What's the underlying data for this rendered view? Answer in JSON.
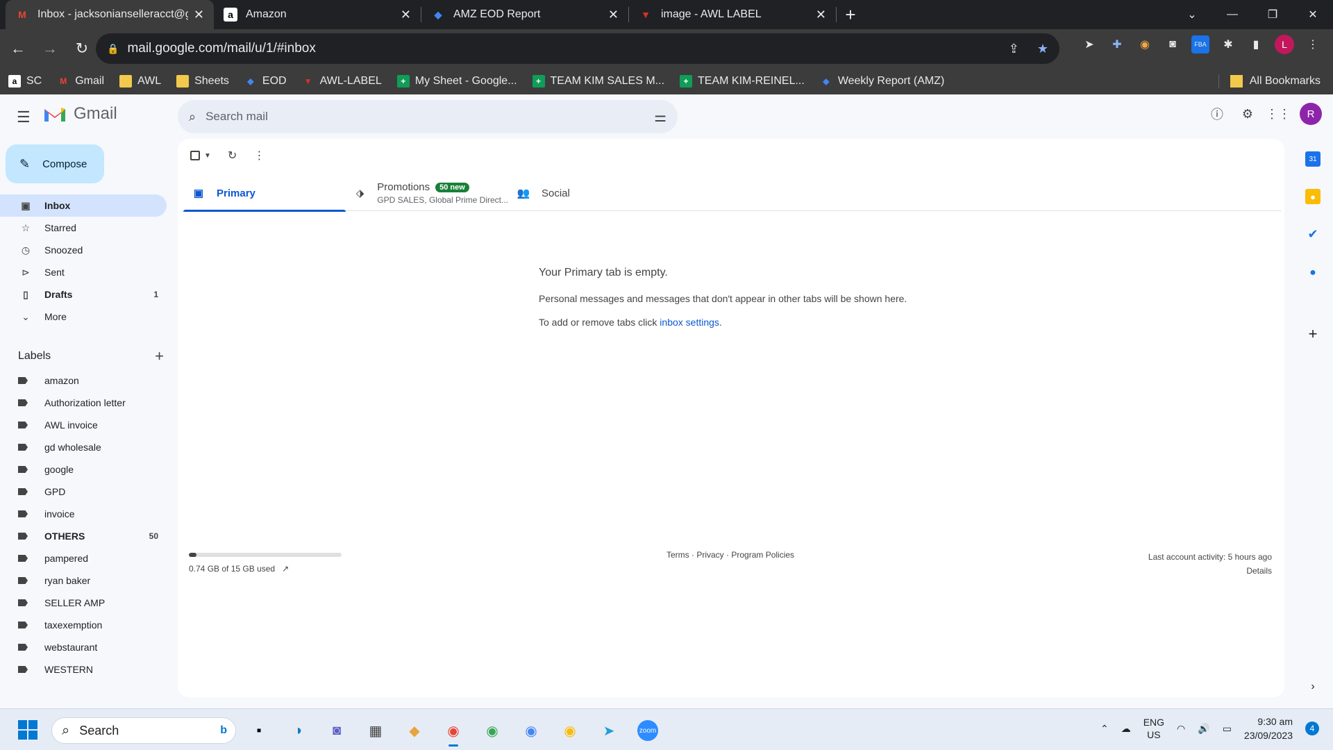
{
  "browser": {
    "tabs": [
      {
        "title": "Inbox - jacksonianselleracct@gm",
        "icon": "gmail-icon"
      },
      {
        "title": "Amazon",
        "icon": "amazon-icon"
      },
      {
        "title": "AMZ EOD Report",
        "icon": "report-icon"
      },
      {
        "title": "image - AWL LABEL",
        "icon": "awl-icon"
      }
    ],
    "url": "mail.google.com/mail/u/1/#inbox",
    "profile_initial": "L",
    "bookmarks": [
      "SC",
      "Gmail",
      "AWL",
      "Sheets",
      "EOD",
      "AWL-LABEL",
      "My Sheet - Google...",
      "TEAM KIM SALES M...",
      "TEAM KIM-REINEL...",
      "Weekly Report (AMZ)"
    ],
    "all_bookmarks": "All Bookmarks"
  },
  "gmail": {
    "logo_text": "Gmail",
    "search_placeholder": "Search mail",
    "account_initial": "R",
    "compose": "Compose",
    "nav": [
      {
        "label": "Inbox",
        "count": ""
      },
      {
        "label": "Starred",
        "count": ""
      },
      {
        "label": "Snoozed",
        "count": ""
      },
      {
        "label": "Sent",
        "count": ""
      },
      {
        "label": "Drafts",
        "count": "1"
      },
      {
        "label": "More",
        "count": ""
      }
    ],
    "labels_title": "Labels",
    "labels": [
      {
        "label": "amazon",
        "count": ""
      },
      {
        "label": "Authorization letter",
        "count": ""
      },
      {
        "label": "AWL invoice",
        "count": ""
      },
      {
        "label": "gd wholesale",
        "count": ""
      },
      {
        "label": "google",
        "count": ""
      },
      {
        "label": "GPD",
        "count": ""
      },
      {
        "label": "invoice",
        "count": ""
      },
      {
        "label": "OTHERS",
        "count": "50"
      },
      {
        "label": "pampered",
        "count": ""
      },
      {
        "label": "ryan baker",
        "count": ""
      },
      {
        "label": "SELLER AMP",
        "count": ""
      },
      {
        "label": "taxexemption",
        "count": ""
      },
      {
        "label": "webstaurant",
        "count": ""
      },
      {
        "label": "WESTERN",
        "count": ""
      }
    ],
    "tabs": {
      "primary": "Primary",
      "promotions": "Promotions",
      "promotions_badge": "50 new",
      "promotions_sub": "GPD SALES, Global Prime Direct...",
      "social": "Social"
    },
    "empty": {
      "heading": "Your Primary tab is empty.",
      "line1": "Personal messages and messages that don't appear in other tabs will be shown here.",
      "line2_prefix": "To add or remove tabs click ",
      "line2_link": "inbox settings",
      "line2_suffix": "."
    },
    "storage": {
      "text": "0.74 GB of 15 GB used",
      "fraction": 0.05
    },
    "footer": {
      "terms": "Terms",
      "privacy": "Privacy",
      "policies": "Program Policies",
      "sep": " · ",
      "activity": "Last account activity: 5 hours ago",
      "details": "Details"
    }
  },
  "taskbar": {
    "search": "Search",
    "lang1": "ENG",
    "lang2": "US",
    "time": "9:30 am",
    "date": "23/09/2023",
    "notifications": "4"
  },
  "colors": {
    "accent": "#0b57d0",
    "compose": "#c2e7ff",
    "badge": "#188038"
  }
}
